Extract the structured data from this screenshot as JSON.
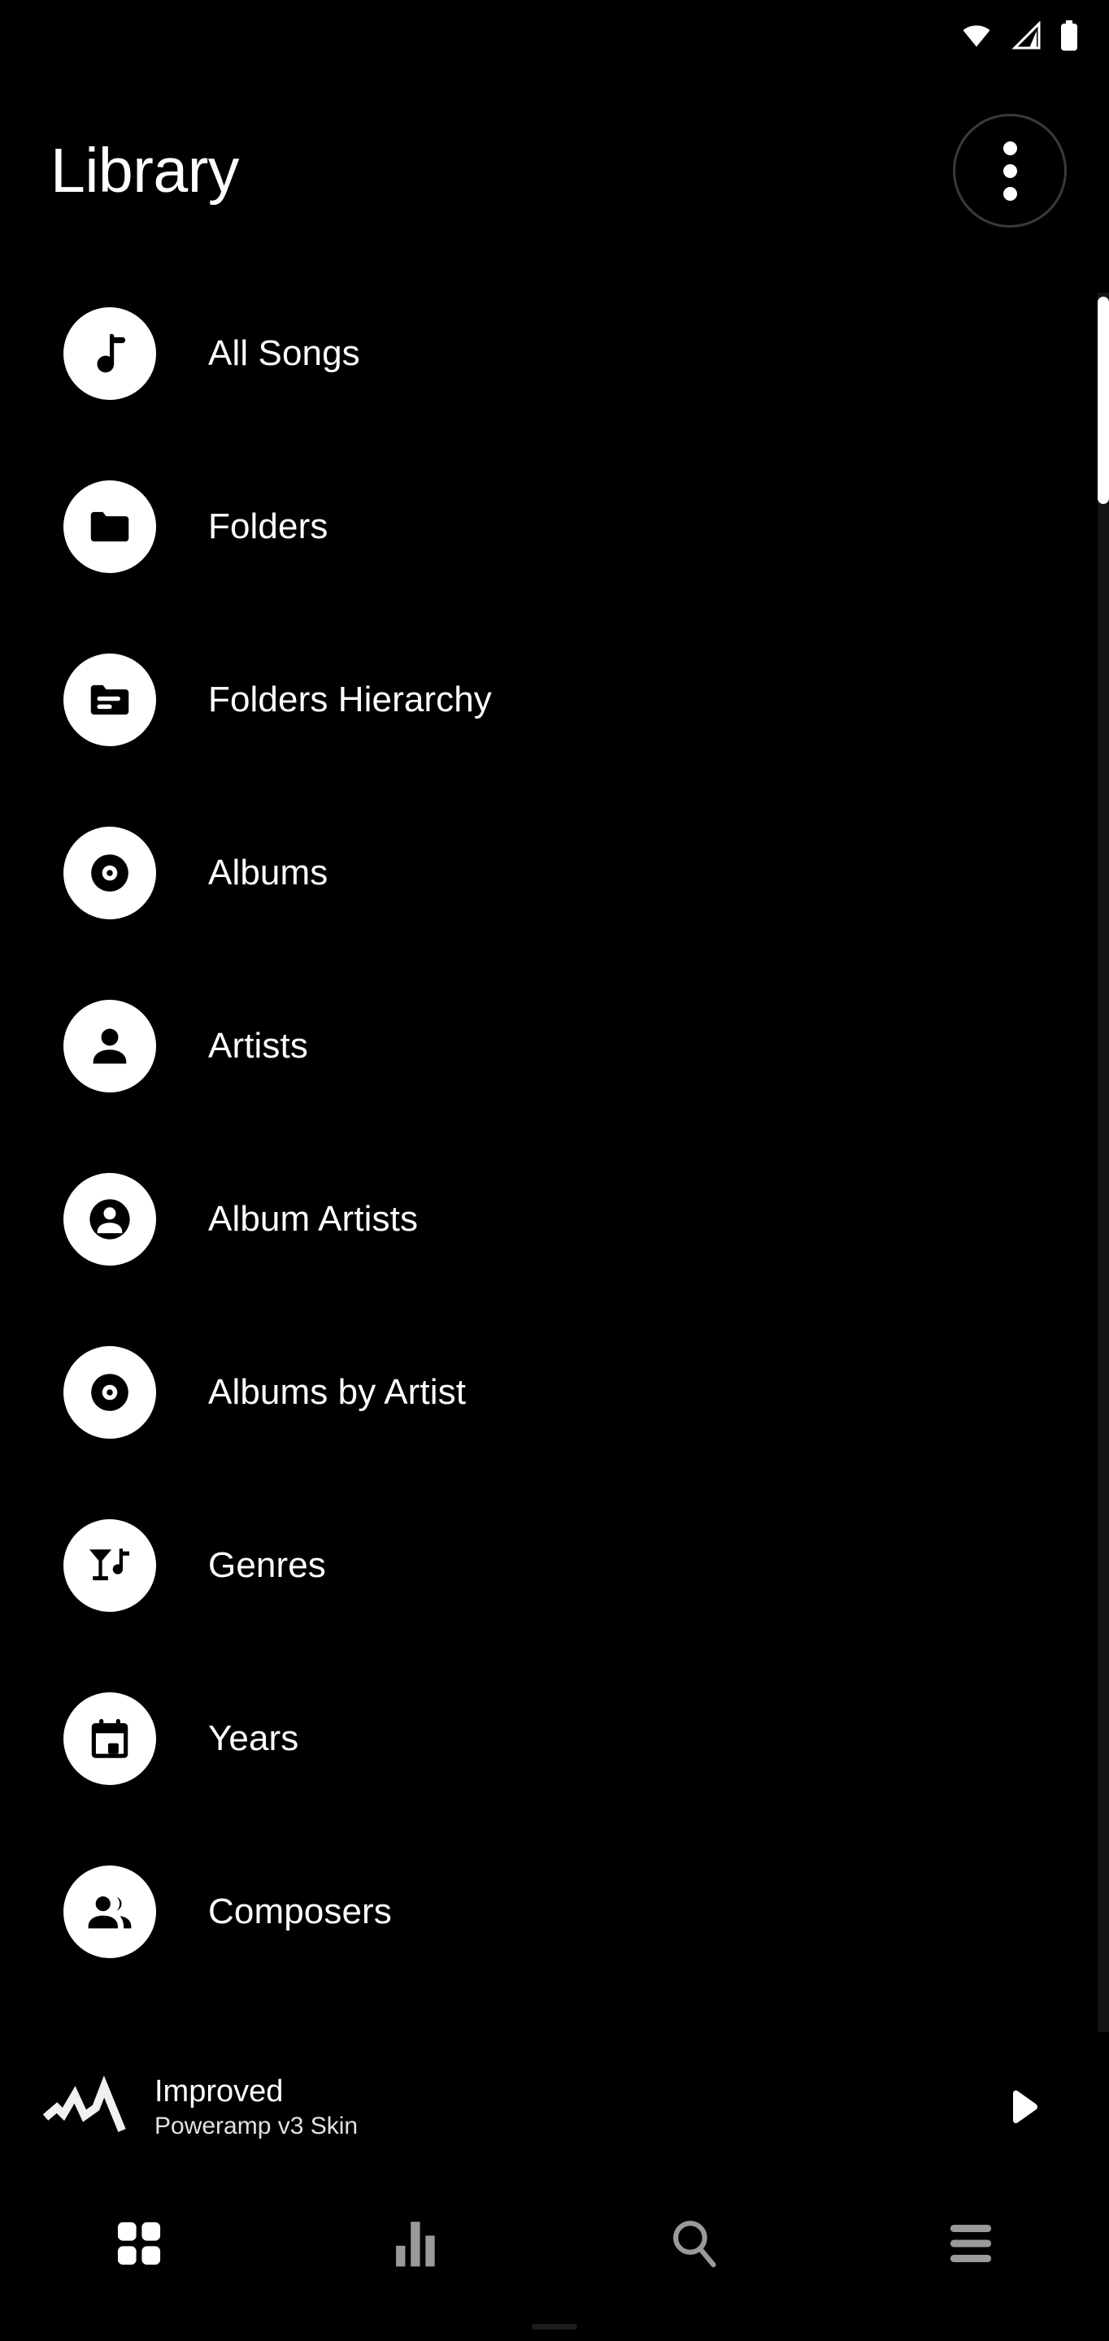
{
  "status_bar": {
    "wifi_icon": "wifi-icon",
    "signal_icon": "cellular-signal-icon",
    "battery_icon": "battery-full-icon"
  },
  "header": {
    "title": "Library",
    "overflow_label": "More options",
    "overflow_icon": "more-vertical-icon"
  },
  "library": {
    "items": [
      {
        "label": "All Songs",
        "icon": "music-note-icon"
      },
      {
        "label": "Folders",
        "icon": "folder-icon"
      },
      {
        "label": "Folders Hierarchy",
        "icon": "folder-lines-icon"
      },
      {
        "label": "Albums",
        "icon": "vinyl-record-icon"
      },
      {
        "label": "Artists",
        "icon": "person-icon"
      },
      {
        "label": "Album Artists",
        "icon": "account-circle-icon"
      },
      {
        "label": "Albums by Artist",
        "icon": "vinyl-record-icon"
      },
      {
        "label": "Genres",
        "icon": "cocktail-note-icon"
      },
      {
        "label": "Years",
        "icon": "calendar-icon"
      },
      {
        "label": "Composers",
        "icon": "people-group-icon"
      }
    ]
  },
  "scrollbar": {
    "thumb_label": "list-scroll-thumb"
  },
  "now_playing": {
    "art_icon": "waveform-art-icon",
    "title": "Improved",
    "subtitle": "Poweramp v3 Skin",
    "play_icon": "play-icon",
    "play_label": "Play"
  },
  "bottom_nav": {
    "tabs": [
      {
        "name": "library",
        "icon": "grid-icon",
        "active": true
      },
      {
        "name": "equalizer",
        "icon": "equalizer-icon",
        "active": false
      },
      {
        "name": "search",
        "icon": "search-icon",
        "active": false
      },
      {
        "name": "menu",
        "icon": "hamburger-icon",
        "active": false
      }
    ]
  },
  "colors": {
    "background": "#000000",
    "text_primary": "#ffffff",
    "icon_active": "#ffffff",
    "icon_inactive": "#9a9a9a",
    "scroll_track": "#141414",
    "outline": "#3a3a3a"
  }
}
